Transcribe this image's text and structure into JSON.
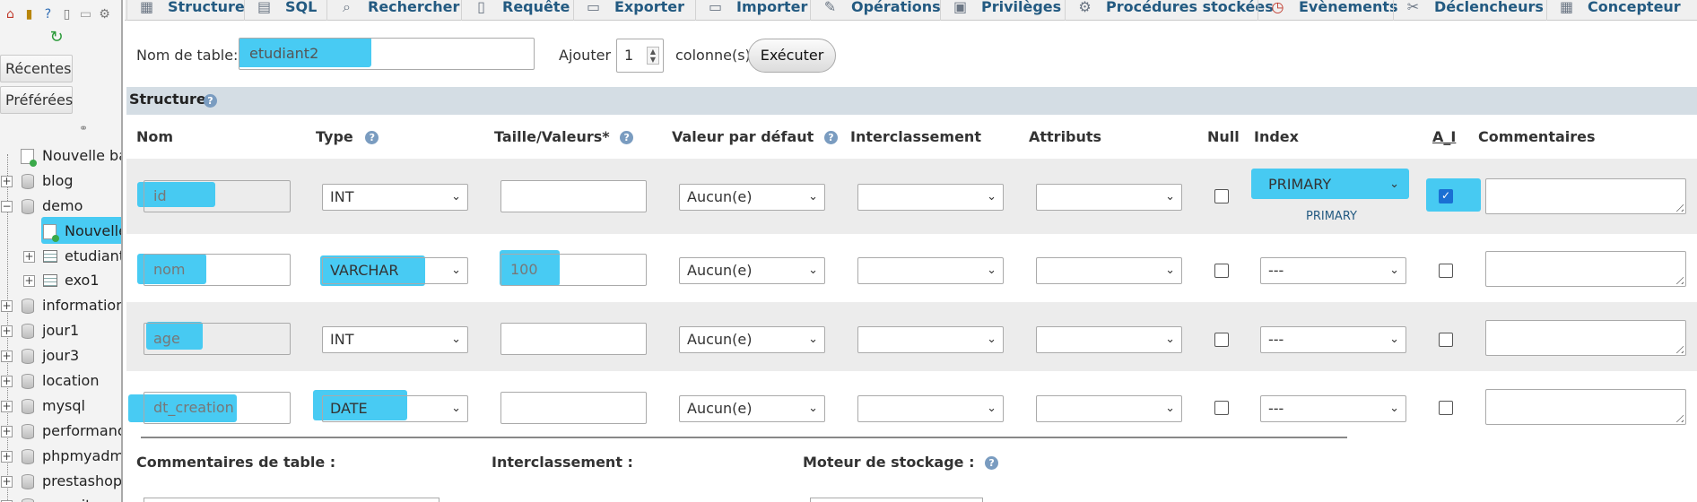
{
  "sidebar": {
    "icons": [
      "home-icon",
      "database-icon",
      "help-icon",
      "docs-icon",
      "page-icon",
      "settings-icon"
    ],
    "reload_icon": "reload-icon",
    "recent_label": "Récentes",
    "favorites_label": "Préférées",
    "tree": [
      {
        "label": "Nouvelle base",
        "kind": "new"
      },
      {
        "label": "blog",
        "kind": "db"
      },
      {
        "label": "demo",
        "kind": "db-open"
      },
      {
        "label": "Nouvelle",
        "kind": "new-child",
        "highlighted": true
      },
      {
        "label": "etudiant",
        "kind": "table"
      },
      {
        "label": "exo1",
        "kind": "table"
      },
      {
        "label": "information_",
        "kind": "db"
      },
      {
        "label": "jour1",
        "kind": "db"
      },
      {
        "label": "jour3",
        "kind": "db"
      },
      {
        "label": "location",
        "kind": "db"
      },
      {
        "label": "mysql",
        "kind": "db"
      },
      {
        "label": "performance",
        "kind": "db"
      },
      {
        "label": "phpmyadmin",
        "kind": "db"
      },
      {
        "label": "prestashop",
        "kind": "db"
      },
      {
        "label": "security",
        "kind": "db"
      }
    ]
  },
  "tabs": [
    {
      "label": "Structure",
      "icon": "structure-icon"
    },
    {
      "label": "SQL",
      "icon": "sql-icon"
    },
    {
      "label": "Rechercher",
      "icon": "search-icon"
    },
    {
      "label": "Requête",
      "icon": "query-icon"
    },
    {
      "label": "Exporter",
      "icon": "export-icon"
    },
    {
      "label": "Importer",
      "icon": "import-icon"
    },
    {
      "label": "Opérations",
      "icon": "wrench-icon"
    },
    {
      "label": "Privilèges",
      "icon": "privileges-icon"
    },
    {
      "label": "Procédures stockées",
      "icon": "routines-icon"
    },
    {
      "label": "Evènements",
      "icon": "clock-icon"
    },
    {
      "label": "Déclencheurs",
      "icon": "triggers-icon"
    },
    {
      "label": "Concepteur",
      "icon": "designer-icon"
    }
  ],
  "form": {
    "table_name_label": "Nom de table:",
    "table_name_value": "etudiant2",
    "add_label": "Ajouter",
    "add_count": "1",
    "columns_label": "colonne(s)",
    "execute_label": "Exécuter"
  },
  "structure": {
    "title": "Structure",
    "headers": {
      "name": "Nom",
      "type": "Type",
      "length": "Taille/Valeurs*",
      "default": "Valeur par défaut",
      "collation": "Interclassement",
      "attributes": "Attributs",
      "null": "Null",
      "index": "Index",
      "ai": "A_I",
      "comments": "Commentaires"
    },
    "rows": [
      {
        "name": "id",
        "type": "INT",
        "length": "",
        "default": "Aucun(e)",
        "collation": "",
        "attributes": "",
        "null": false,
        "index": "PRIMARY",
        "index_note": "PRIMARY",
        "ai": true
      },
      {
        "name": "nom",
        "type": "VARCHAR",
        "length": "100",
        "default": "Aucun(e)",
        "collation": "",
        "attributes": "",
        "null": false,
        "index": "---",
        "index_note": "",
        "ai": false
      },
      {
        "name": "age",
        "type": "INT",
        "length": "",
        "default": "Aucun(e)",
        "collation": "",
        "attributes": "",
        "null": false,
        "index": "---",
        "index_note": "",
        "ai": false
      },
      {
        "name": "dt_creation",
        "type": "DATE",
        "length": "",
        "default": "Aucun(e)",
        "collation": "",
        "attributes": "",
        "null": false,
        "index": "---",
        "index_note": "",
        "ai": false
      }
    ]
  },
  "footer": {
    "table_comments_label": "Commentaires de table :",
    "collation_label": "Interclassement :",
    "engine_label": "Moteur de stockage :"
  },
  "colors": {
    "highlight": "#3ec8f2",
    "link": "#235a81",
    "section_bg": "#d4dde4"
  }
}
